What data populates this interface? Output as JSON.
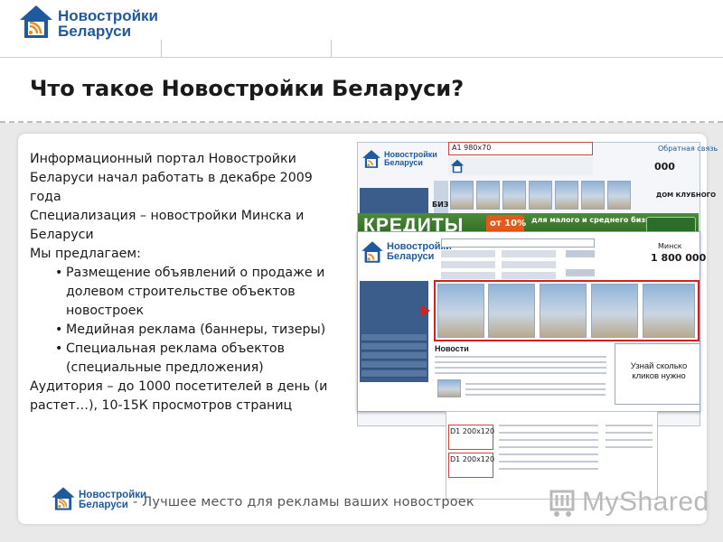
{
  "brand": {
    "name_line1": "Новостройки",
    "name_line2": "Беларуси",
    "accent_color": "#1f5a9e"
  },
  "slide": {
    "title": "Что такое Новостройки Беларуси?",
    "paragraphs": [
      "Информационный  портал Новостройки Беларуси начал работать в декабре 2009 года",
      "Специализация  – новостройки Минска и Беларуси",
      "Мы предлагаем:"
    ],
    "bullets": [
      "Размещение объявлений о продаже и долевом строительстве объектов новостроек",
      "Медийная реклама (баннеры, тизеры)",
      "Специальная реклама объектов (специальные предложения)"
    ],
    "audience": "Аудитория  – до 1000 посетителей  в день (и растет…), 10-15К просмотров страниц"
  },
  "mockup": {
    "banner_a1": "A1 980x70",
    "banner_d1_first": "D1 200x120",
    "banner_d1_second": "D1 200x120",
    "credit_banner": "КРЕДИТЫ",
    "news_heading": "Новости",
    "ad_text": "Узнай сколько кликов нужно",
    "price": "1 800 000",
    "city": "Минск"
  },
  "footer": {
    "tagline": "- Лучшее место для рекламы ваших новостроек",
    "watermark": "MyShared"
  }
}
